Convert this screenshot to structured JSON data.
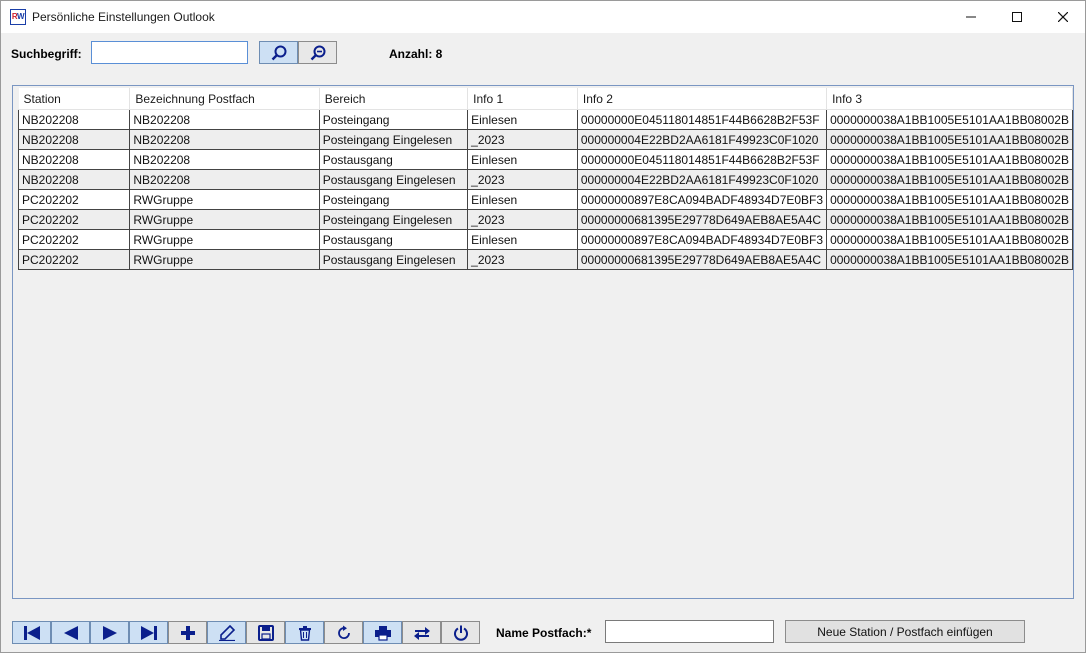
{
  "window": {
    "title": "Persönliche Einstellungen Outlook",
    "icon": "rw-app-icon",
    "controls": [
      "minimize-icon",
      "maximize-icon",
      "close-icon"
    ]
  },
  "search": {
    "label": "Suchbegriff:",
    "value": "",
    "buttons": [
      "zoom-in-search-icon",
      "zoom-out-search-icon"
    ],
    "count_label": "Anzahl: 8"
  },
  "grid": {
    "columns": [
      "Station",
      "Bezeichnung Postfach",
      "Bereich",
      "Info 1",
      "Info 2",
      "Info 3"
    ],
    "rows": [
      [
        "NB202208",
        "NB202208",
        "Posteingang",
        "Einlesen",
        "00000000E045118014851F44B6628B2F53F",
        "0000000038A1BB1005E5101AA1BB08002B"
      ],
      [
        "NB202208",
        "NB202208",
        "Posteingang Eingelesen",
        "_2023",
        "000000004E22BD2AA6181F49923C0F1020",
        "0000000038A1BB1005E5101AA1BB08002B"
      ],
      [
        "NB202208",
        "NB202208",
        "Postausgang",
        "Einlesen",
        "00000000E045118014851F44B6628B2F53F",
        "0000000038A1BB1005E5101AA1BB08002B"
      ],
      [
        "NB202208",
        "NB202208",
        "Postausgang Eingelesen",
        "_2023",
        "000000004E22BD2AA6181F49923C0F1020",
        "0000000038A1BB1005E5101AA1BB08002B"
      ],
      [
        "PC202202",
        "RWGruppe",
        "Posteingang",
        "Einlesen",
        "00000000897E8CA094BADF48934D7E0BF3",
        "0000000038A1BB1005E5101AA1BB08002B"
      ],
      [
        "PC202202",
        "RWGruppe",
        "Posteingang Eingelesen",
        "_2023",
        "00000000681395E29778D649AEB8AE5A4C",
        "0000000038A1BB1005E5101AA1BB08002B"
      ],
      [
        "PC202202",
        "RWGruppe",
        "Postausgang",
        "Einlesen",
        "00000000897E8CA094BADF48934D7E0BF3",
        "0000000038A1BB1005E5101AA1BB08002B"
      ],
      [
        "PC202202",
        "RWGruppe",
        "Postausgang Eingelesen",
        "_2023",
        "00000000681395E29778D649AEB8AE5A4C",
        "0000000038A1BB1005E5101AA1BB08002B"
      ]
    ]
  },
  "navigation": {
    "buttons": [
      "first-record-icon",
      "previous-record-icon",
      "next-record-icon",
      "last-record-icon",
      "add-icon",
      "edit-icon",
      "save-icon",
      "delete-icon",
      "refresh-icon",
      "print-icon",
      "transfer-icon",
      "power-icon"
    ]
  },
  "footer": {
    "name_label": "Name Postfach:*",
    "name_value": "",
    "insert_button": "Neue Station / Postfach einfügen"
  },
  "colors": {
    "icon_blue": "#0b1f8c",
    "selected_button": "#cde0f4",
    "grid_border": "#7a96c2"
  }
}
